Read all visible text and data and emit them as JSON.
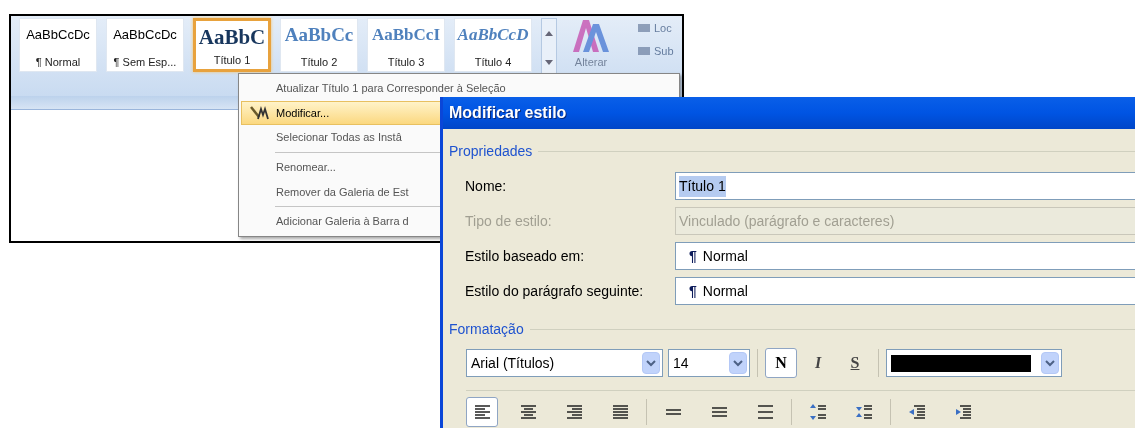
{
  "ribbon": {
    "styles": [
      {
        "preview": "AaBbCcDc",
        "label": "¶ Normal",
        "kind": "body",
        "selected": false
      },
      {
        "preview": "AaBbCcDc",
        "label": "¶ Sem Esp...",
        "kind": "body",
        "selected": false
      },
      {
        "preview": "AaBbC",
        "label": "Título 1",
        "kind": "heading1",
        "selected": true
      },
      {
        "preview": "AaBbCc",
        "label": "Título 2",
        "kind": "heading2",
        "selected": false
      },
      {
        "preview": "AaBbCcI",
        "label": "Título 3",
        "kind": "heading3",
        "selected": false
      },
      {
        "preview": "AaBbCcD",
        "label": "Título 4",
        "kind": "heading4",
        "selected": false
      }
    ],
    "change_styles_label": "Alterar",
    "side_buttons": [
      "Loc",
      "Sub"
    ]
  },
  "context_menu": {
    "groups": [
      [
        {
          "label": "Atualizar Título 1 para Corresponder à Seleção",
          "selected": false,
          "icon": false
        },
        {
          "label": "Modificar...",
          "selected": true,
          "icon": true
        },
        {
          "label": "Selecionar Todas as Instâ",
          "selected": false,
          "icon": false
        }
      ],
      [
        {
          "label": "Renomear...",
          "selected": false,
          "icon": false
        },
        {
          "label": "Remover da Galeria de Est",
          "selected": false,
          "icon": false
        }
      ],
      [
        {
          "label": "Adicionar Galeria à Barra d",
          "selected": false,
          "icon": false
        }
      ]
    ]
  },
  "dialog": {
    "title": "Modificar estilo",
    "properties": {
      "heading": "Propriedades",
      "fields": [
        {
          "label": "Nome:",
          "value": "Título 1",
          "kind": "text",
          "disabled": false,
          "text_selected": true
        },
        {
          "label": "Tipo de estilo:",
          "value": "Vinculado (parágrafo e caracteres)",
          "kind": "text",
          "disabled": true,
          "text_selected": false
        },
        {
          "label": "Estilo baseado em:",
          "value": "Normal",
          "mark": "¶",
          "kind": "style",
          "disabled": false,
          "text_selected": false
        },
        {
          "label": "Estilo do parágrafo seguinte:",
          "value": "Normal",
          "mark": "¶",
          "kind": "style",
          "disabled": false,
          "text_selected": false
        }
      ]
    },
    "formatting": {
      "heading": "Formatação",
      "font": "Arial (Títulos)",
      "size": "14",
      "text_styles": [
        {
          "label": "N",
          "kind": "bold",
          "selected": true
        },
        {
          "label": "I",
          "kind": "italic",
          "selected": false
        },
        {
          "label": "S",
          "kind": "underline",
          "selected": false
        }
      ],
      "color": "#000000",
      "paragraph_groups": [
        [
          {
            "kind": "align-left",
            "selected": true
          },
          {
            "kind": "align-center",
            "selected": false
          },
          {
            "kind": "align-right",
            "selected": false
          },
          {
            "kind": "justify",
            "selected": false
          }
        ],
        [
          {
            "kind": "single-spacing",
            "selected": false
          },
          {
            "kind": "one-half-spacing",
            "selected": false
          },
          {
            "kind": "double-spacing",
            "selected": false
          }
        ],
        [
          {
            "kind": "space-before",
            "selected": false
          },
          {
            "kind": "space-after",
            "selected": false
          }
        ],
        [
          {
            "kind": "decrease-indent",
            "selected": false
          },
          {
            "kind": "increase-indent",
            "selected": false
          }
        ]
      ]
    }
  }
}
